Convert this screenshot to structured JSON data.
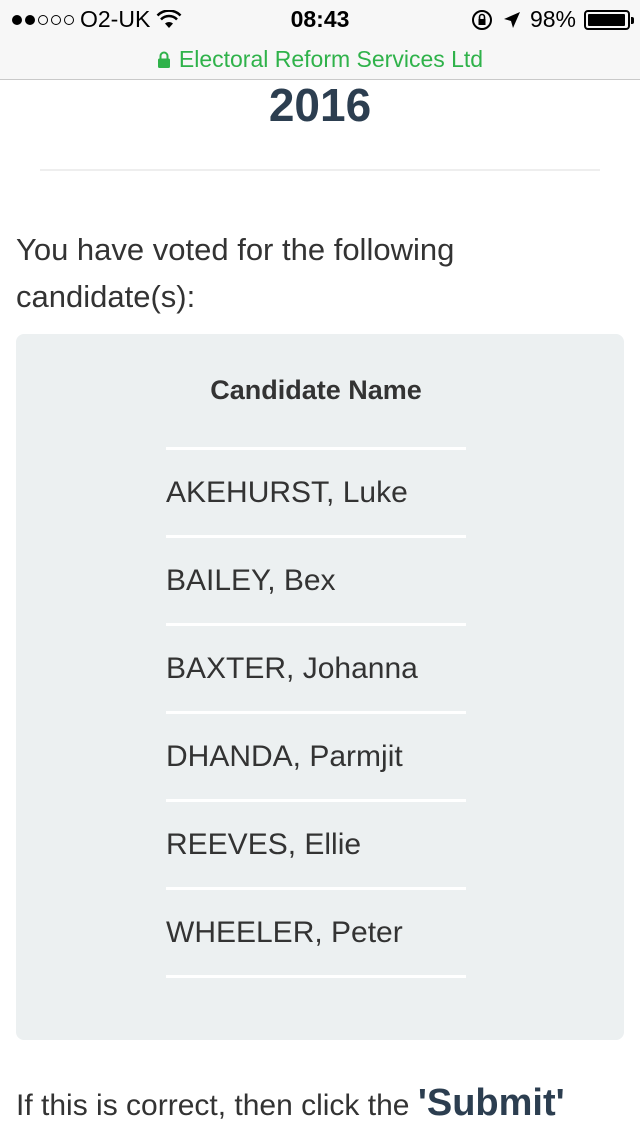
{
  "status_bar": {
    "carrier": "O2-UK",
    "time": "08:43",
    "battery_percent": "98%",
    "battery_level": 0.98
  },
  "url_bar": {
    "site": "Electoral Reform Services Ltd",
    "color": "#2fb24a"
  },
  "page": {
    "year": "2016",
    "intro": "You have voted for the following candidate(s):",
    "table": {
      "header": "Candidate Name",
      "rows": [
        "AKEHURST, Luke",
        "BAILEY, Bex",
        "BAXTER, Johanna",
        "DHANDA, Parmjit",
        "REEVES, Ellie",
        "WHEELER, Peter"
      ]
    },
    "footer": {
      "text": "If this is correct, then click the ",
      "submit": "'Submit'"
    }
  }
}
